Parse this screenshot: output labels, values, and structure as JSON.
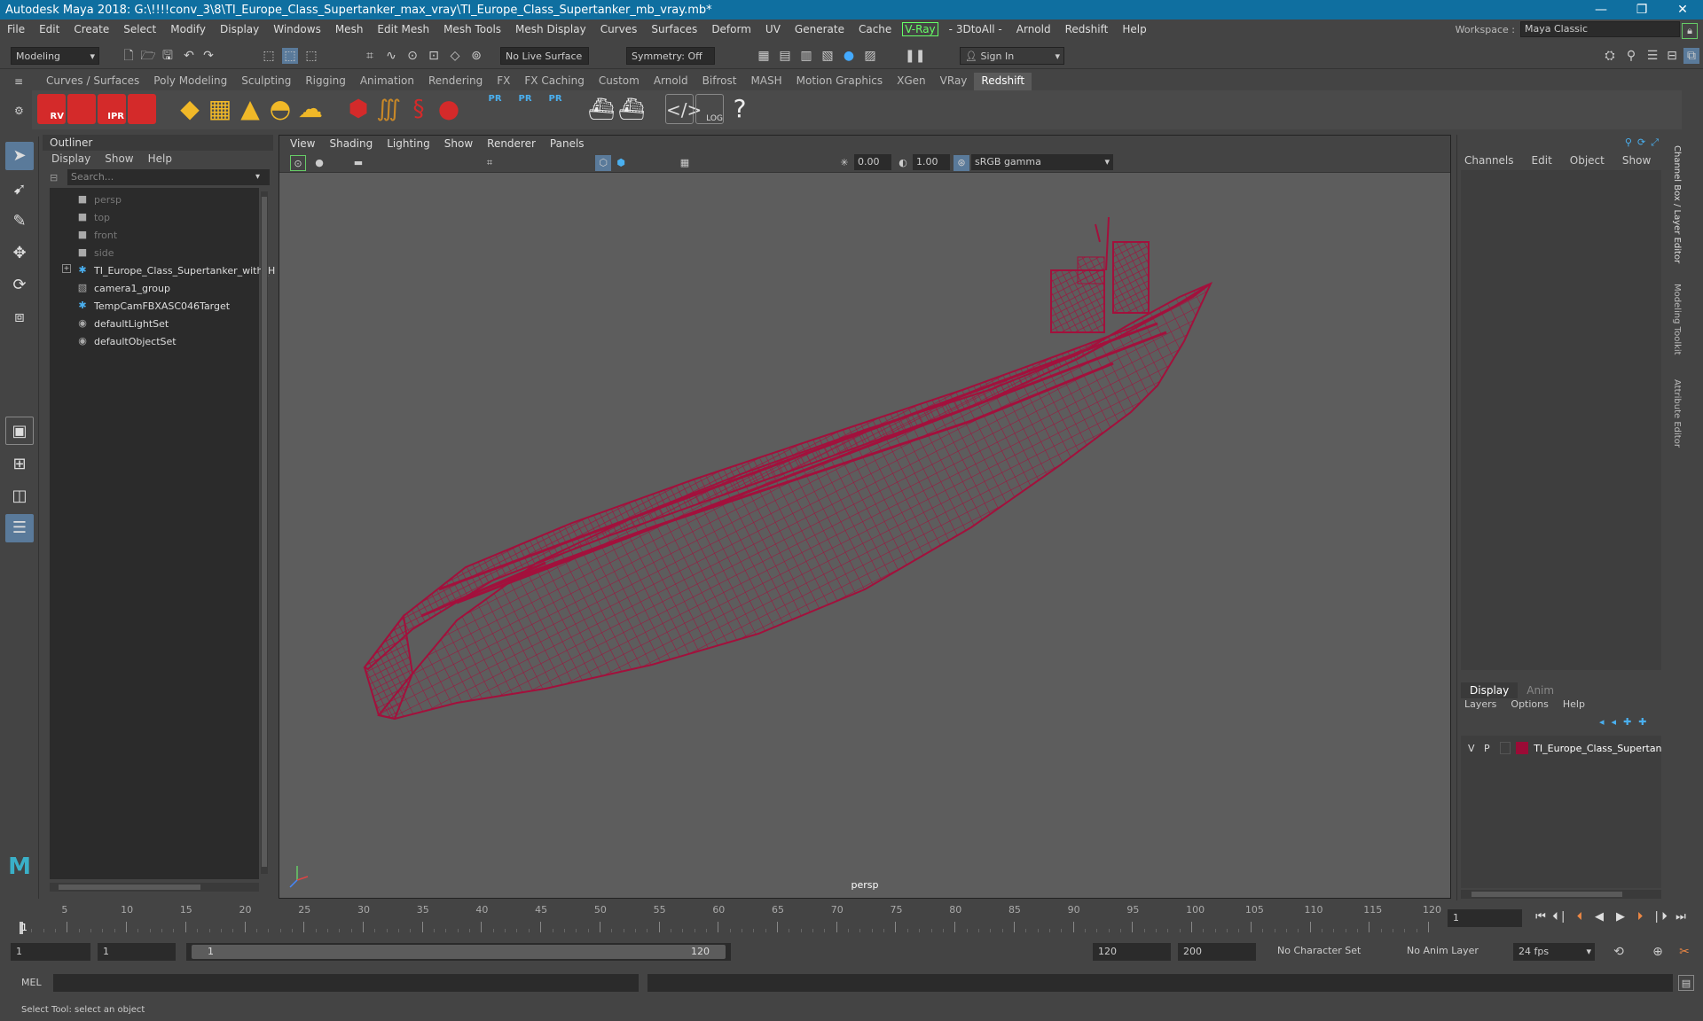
{
  "titlebar": {
    "title": "Autodesk Maya 2018: G:\\!!!!conv_3\\8\\TI_Europe_Class_Supertanker_max_vray\\TI_Europe_Class_Supertanker_mb_vray.mb*",
    "minimize": "—",
    "restore": "❐",
    "close": "✕"
  },
  "menus": [
    "File",
    "Edit",
    "Create",
    "Select",
    "Modify",
    "Display",
    "Windows",
    "Mesh",
    "Edit Mesh",
    "Mesh Tools",
    "Mesh Display",
    "Curves",
    "Surfaces",
    "Deform",
    "UV",
    "Generate",
    "Cache"
  ],
  "menu_vray": "V-Ray",
  "menus2": [
    "- 3DtoAll -",
    "Arnold",
    "Redshift",
    "Help"
  ],
  "workspace": {
    "label": "Workspace :",
    "value": "Maya Classic"
  },
  "status": {
    "mode": "Modeling",
    "live_surface": "No Live Surface",
    "symmetry": "Symmetry: Off",
    "signin": "Sign In"
  },
  "shelf_tabs": [
    "Curves / Surfaces",
    "Poly Modeling",
    "Sculpting",
    "Rigging",
    "Animation",
    "Rendering",
    "FX",
    "FX Caching",
    "Custom",
    "Arnold",
    "Bifrost",
    "MASH",
    "Motion Graphics",
    "XGen",
    "VRay",
    "Redshift"
  ],
  "shelf_active": "Redshift",
  "shelf_labels": {
    "rv": "RV",
    "ipr": "IPR",
    "pr": "PR",
    "log": "LOG",
    "help": "?"
  },
  "outliner": {
    "title": "Outliner",
    "menus": [
      "Display",
      "Show",
      "Help"
    ],
    "search_placeholder": "Search...",
    "items": [
      {
        "label": "persp",
        "icon": "camera-icon",
        "dim": true
      },
      {
        "label": "top",
        "icon": "camera-icon",
        "dim": true
      },
      {
        "label": "front",
        "icon": "camera-icon",
        "dim": true
      },
      {
        "label": "side",
        "icon": "camera-icon",
        "dim": true
      },
      {
        "label": "TI_Europe_Class_Supertanker_with_H",
        "icon": "locator-icon",
        "dim": false
      },
      {
        "label": "camera1_group",
        "icon": "group-icon",
        "dim": false
      },
      {
        "label": "TempCamFBXASC046Target",
        "icon": "locator-icon",
        "dim": false
      },
      {
        "label": "defaultLightSet",
        "icon": "set-icon",
        "dim": false
      },
      {
        "label": "defaultObjectSet",
        "icon": "set-icon",
        "dim": false
      }
    ]
  },
  "viewport": {
    "menus": [
      "View",
      "Shading",
      "Lighting",
      "Show",
      "Renderer",
      "Panels"
    ],
    "exposure": "0.00",
    "gamma": "1.00",
    "colorspace": "sRGB gamma",
    "camera_label": "persp",
    "wire_color": "#a3103c"
  },
  "channelbox": {
    "menus": [
      "Channels",
      "Edit",
      "Object",
      "Show"
    ],
    "side_tabs": [
      "Channel Box / Layer Editor",
      "Modeling Toolkit",
      "Attribute Editor"
    ],
    "layer_tabs": [
      "Display",
      "Anim"
    ],
    "layer_menus": [
      "Layers",
      "Options",
      "Help"
    ],
    "layer": {
      "v": "V",
      "p": "P",
      "name": "TI_Europe_Class_Supertanker_",
      "color": "#9b0b36"
    }
  },
  "timeline": {
    "ticks": [
      "5",
      "10",
      "15",
      "20",
      "25",
      "30",
      "35",
      "40",
      "45",
      "50",
      "55",
      "60",
      "65",
      "70",
      "75",
      "80",
      "85",
      "90",
      "95",
      "100",
      "105",
      "110",
      "115",
      "120"
    ],
    "start_marker": "1",
    "current_frame": "1"
  },
  "range": {
    "start": "1",
    "anim_start": "1",
    "range_start": "1",
    "range_end": "120",
    "end": "120",
    "anim_end": "200",
    "character_set": "No Character Set",
    "anim_layer": "No Anim Layer",
    "fps": "24 fps"
  },
  "cmd": {
    "label": "MEL"
  },
  "help_text": "Select Tool: select an object"
}
